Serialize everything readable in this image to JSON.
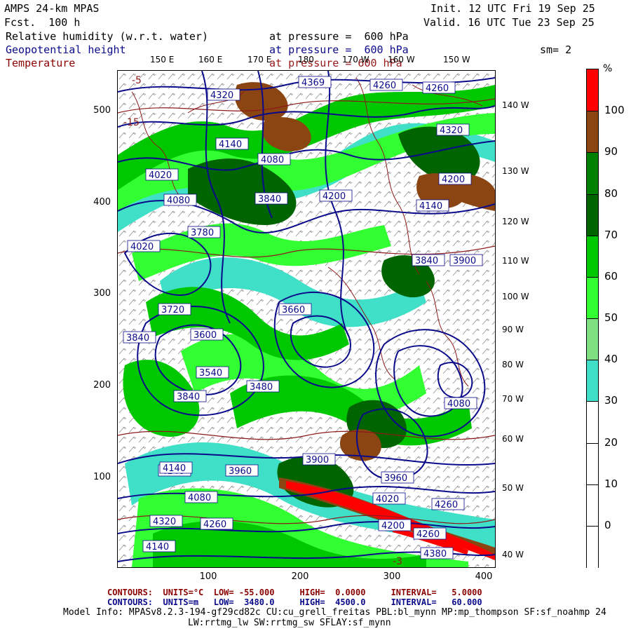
{
  "header": {
    "model": "AMPS 24-km MPAS",
    "fcst": "Fcst.  100 h",
    "init": "Init. 12 UTC Fri 19 Sep 25",
    "valid": "Valid. 16 UTC Tue 23 Sep 25",
    "field1": "Relative humidity (w.r.t. water)",
    "field1_level": "at pressure =  600 hPa",
    "field2": "Geopotential height",
    "field2_level": "at pressure =  600 hPa",
    "field3": "Temperature",
    "field3_level": "at pressure = 600 hPa",
    "smooth": "sm= 2"
  },
  "axes": {
    "y_ticks": [
      "500",
      "400",
      "300",
      "200",
      "100"
    ],
    "x_ticks": [
      "100",
      "200",
      "300",
      "400"
    ],
    "top_lon": [
      "150 E",
      "160 E",
      "170 E",
      "180",
      "170 W",
      "160 W",
      "150 W"
    ],
    "right_lon": [
      "140 W",
      "130 W",
      "120 W",
      "110 W",
      "100 W",
      "90 W",
      "80 W",
      "70 W",
      "60 W",
      "50 W",
      "40 W"
    ]
  },
  "colorbar": {
    "unit": "%",
    "levels": [
      "100",
      "90",
      "80",
      "70",
      "60",
      "50",
      "40",
      "30",
      "20",
      "10",
      "0"
    ],
    "colors": [
      "#ff0000",
      "#8b4513",
      "#008000",
      "#006400",
      "#00c800",
      "#32ff32",
      "#7fe07f",
      "#40e0c8",
      "#ffffff",
      "#ffffff",
      "#ffffff",
      "#ffffff"
    ]
  },
  "map": {
    "height_labels": [
      "4369",
      "4260",
      "4260",
      "4320",
      "4320",
      "4140",
      "4080",
      "4020",
      "4200",
      "3840",
      "4080",
      "4200",
      "4140",
      "4020",
      "3900",
      "3840",
      "3780",
      "3720",
      "3660",
      "3840",
      "3600",
      "3480",
      "3540",
      "3840",
      "3900",
      "3960",
      "4140",
      "4260",
      "4320",
      "4140",
      "4080",
      "4200",
      "4260",
      "4380",
      "4260",
      "4140",
      "4020",
      "3960",
      "4080"
    ],
    "temp_labels": [
      "-5",
      "-15",
      "-3"
    ]
  },
  "footer": {
    "line1": "CONTOURS:  UNITS=°C  LOW= -55.000     HIGH=  0.0000     INTERVAL=   5.0000",
    "line2": "CONTOURS:  UNITS=m   LOW=  3480.0     HIGH=  4500.0     INTERVAL=   60.000",
    "model_info": "Model Info: MPASv8.2.3-194-gf29cd82c CU:cu_grell_freitas PBL:bl_mynn MP:mp_thompson SF:sf_noahmp 24",
    "model_info2": "LW:rrtmg_lw SW:rrtmg_sw SFLAY:sf_mynn"
  }
}
